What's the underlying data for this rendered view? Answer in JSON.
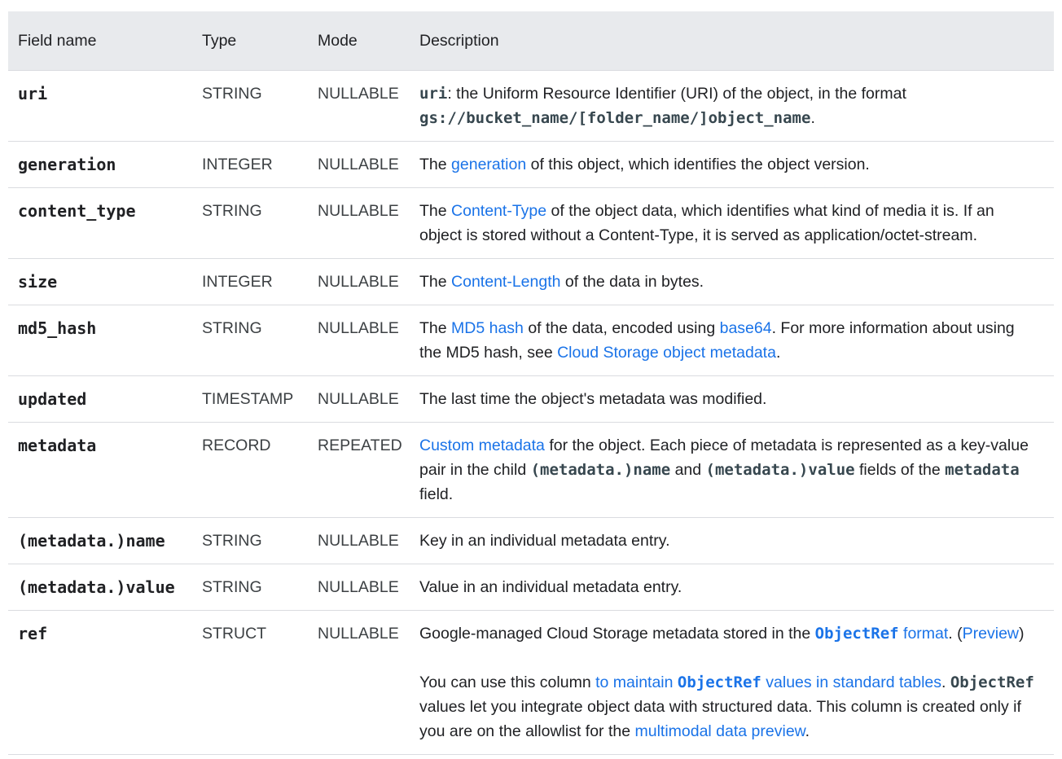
{
  "headers": {
    "field": "Field name",
    "type": "Type",
    "mode": "Mode",
    "description": "Description"
  },
  "rows": [
    {
      "field": "uri",
      "type": "STRING",
      "mode": "NULLABLE",
      "d": {
        "c1": "uri",
        "t1": ": the Uniform Resource Identifier (URI) of the object, in the format ",
        "c2": "gs://bucket_name/[folder_name/]object_name",
        "t2": "."
      }
    },
    {
      "field": "generation",
      "type": "INTEGER",
      "mode": "NULLABLE",
      "d": {
        "t1": "The ",
        "l1": "generation",
        "t2": " of this object, which identifies the object version."
      }
    },
    {
      "field": "content_type",
      "type": "STRING",
      "mode": "NULLABLE",
      "d": {
        "t1": "The ",
        "l1": "Content-Type",
        "t2": " of the object data, which identifies what kind of media it is. If an object is stored without a Content-Type, it is served as application/octet-stream."
      }
    },
    {
      "field": "size",
      "type": "INTEGER",
      "mode": "NULLABLE",
      "d": {
        "t1": "The ",
        "l1": "Content-Length",
        "t2": " of the data in bytes."
      }
    },
    {
      "field": "md5_hash",
      "type": "STRING",
      "mode": "NULLABLE",
      "d": {
        "t1": "The ",
        "l1": "MD5 hash",
        "t2": " of the data, encoded using ",
        "l2": "base64",
        "t3": ". For more information about using the MD5 hash, see ",
        "l3": "Cloud Storage object metadata",
        "t4": "."
      }
    },
    {
      "field": "updated",
      "type": "TIMESTAMP",
      "mode": "NULLABLE",
      "d": {
        "t1": "The last time the object's metadata was modified."
      }
    },
    {
      "field": "metadata",
      "type": "RECORD",
      "mode": "REPEATED",
      "d": {
        "l1": "Custom metadata",
        "t1": " for the object. Each piece of metadata is represented as a key-value pair in the child ",
        "c1": "(metadata.)name",
        "t2": " and ",
        "c2": "(metadata.)value",
        "t3": " fields of the ",
        "c3": "metadata",
        "t4": " field."
      }
    },
    {
      "field": "(metadata.)name",
      "type": "STRING",
      "mode": "NULLABLE",
      "d": {
        "t1": "Key in an individual metadata entry."
      }
    },
    {
      "field": "(metadata.)value",
      "type": "STRING",
      "mode": "NULLABLE",
      "d": {
        "t1": "Value in an individual metadata entry."
      }
    },
    {
      "field": "ref",
      "type": "STRUCT",
      "mode": "NULLABLE",
      "d": {
        "t1": "Google-managed Cloud Storage metadata stored in the ",
        "lc1": "ObjectRef",
        "l1": " format",
        "t2": ". (",
        "l2": "Preview",
        "t3": ")",
        "t4": "You can use this column ",
        "l3": "to maintain ",
        "lc2": "ObjectRef",
        "l4": " values in standard tables",
        "t5": ". ",
        "c1": "ObjectRef",
        "t6": " values let you integrate object data with structured data. This column is created only if you are on the allowlist for the ",
        "l5": "multimodal data preview",
        "t7": "."
      }
    }
  ]
}
